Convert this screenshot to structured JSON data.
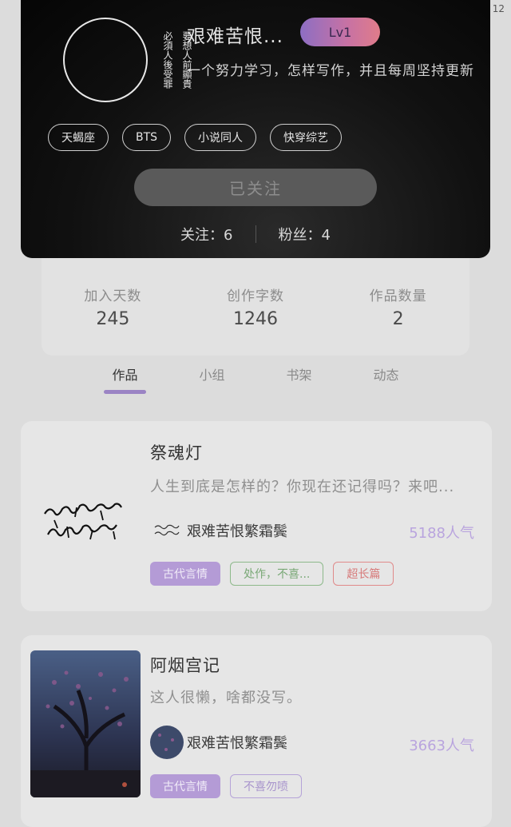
{
  "status_bar": {
    "time": "12"
  },
  "profile": {
    "avatar_seal_columns": [
      "要想人前顯貴",
      "必須人後受罪"
    ],
    "username": "艰难苦恨...",
    "level": "Lv1",
    "bio": "一个努力学习，怎样写作，并且每周坚持更新",
    "tags": [
      "天蝎座",
      "BTS",
      "小说同人",
      "快穿综艺"
    ],
    "follow_button": "已关注",
    "following_text": "关注：6",
    "fans_text": "粉丝：4"
  },
  "stats": [
    {
      "label": "加入天数",
      "value": "245"
    },
    {
      "label": "创作字数",
      "value": "1246"
    },
    {
      "label": "作品数量",
      "value": "2"
    }
  ],
  "tabs": [
    "作品",
    "小组",
    "书架",
    "动态"
  ],
  "active_tab": "作品",
  "works": [
    {
      "title": "祭魂灯",
      "summary": "人生到底是怎样的？你现在还记得吗？来吧...",
      "author": "艰难苦恨繁霜鬓",
      "popularity": "5188人气",
      "cover_text": [
        "朋友有朋友.",
        "朋友有朋友."
      ],
      "tags": [
        {
          "label": "古代言情",
          "style": "purple"
        },
        {
          "label": "处作，不喜...",
          "style": "green"
        },
        {
          "label": "超长篇",
          "style": "red"
        }
      ]
    },
    {
      "title": "阿烟宫记",
      "summary": "这人很懒，啥都没写。",
      "author": "艰难苦恨繁霜鬓",
      "popularity": "3663人气",
      "tags": [
        {
          "label": "古代言情",
          "style": "purple"
        },
        {
          "label": "不喜勿喷",
          "style": "violet"
        }
      ]
    }
  ],
  "colors": {
    "accent": "#9b84c4",
    "popularity": "#b9a4de",
    "level_gradient": [
      "#8d6ec3",
      "#e07c8a"
    ]
  }
}
